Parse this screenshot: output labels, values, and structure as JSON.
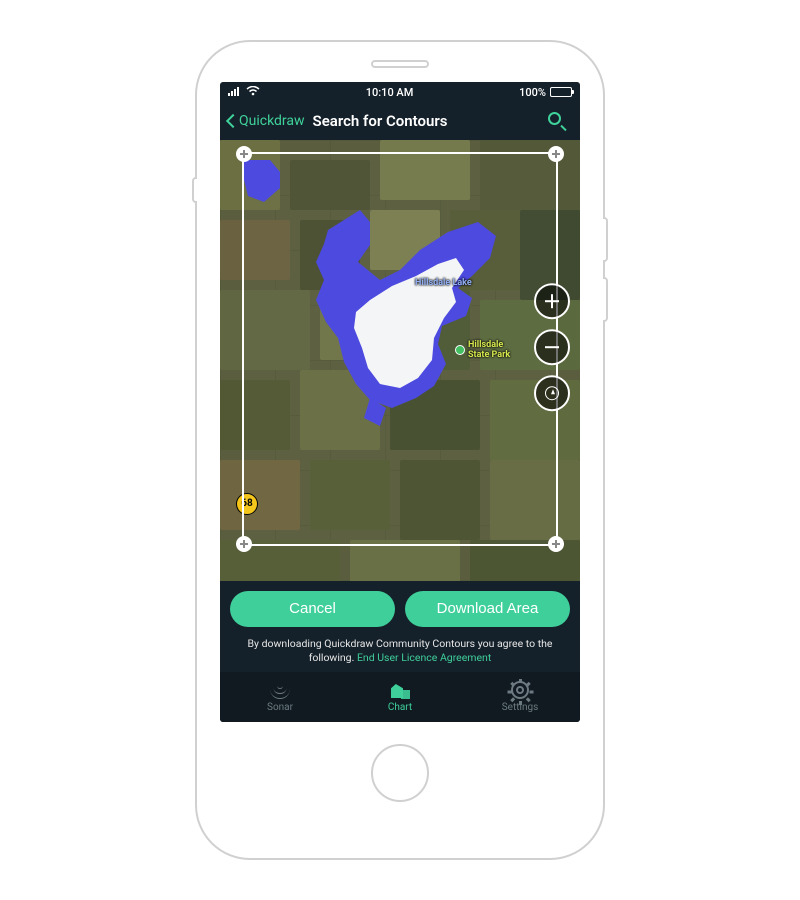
{
  "status": {
    "time": "10:10 AM",
    "battery_pct": "100%"
  },
  "nav": {
    "back_label": "Quickdraw",
    "title": "Search for Contours"
  },
  "map": {
    "lake_label": "Hillsdale Lake",
    "park_label": "Hillsdale\nState Park",
    "route_number": "68"
  },
  "buttons": {
    "cancel": "Cancel",
    "download": "Download Area"
  },
  "disclaimer": {
    "text": "By downloading Quickdraw Community Contours you agree to the following.",
    "link_label": "End User Licence Agreement"
  },
  "tabs": {
    "sonar": "Sonar",
    "chart": "Chart",
    "settings": "Settings",
    "active": "chart"
  }
}
